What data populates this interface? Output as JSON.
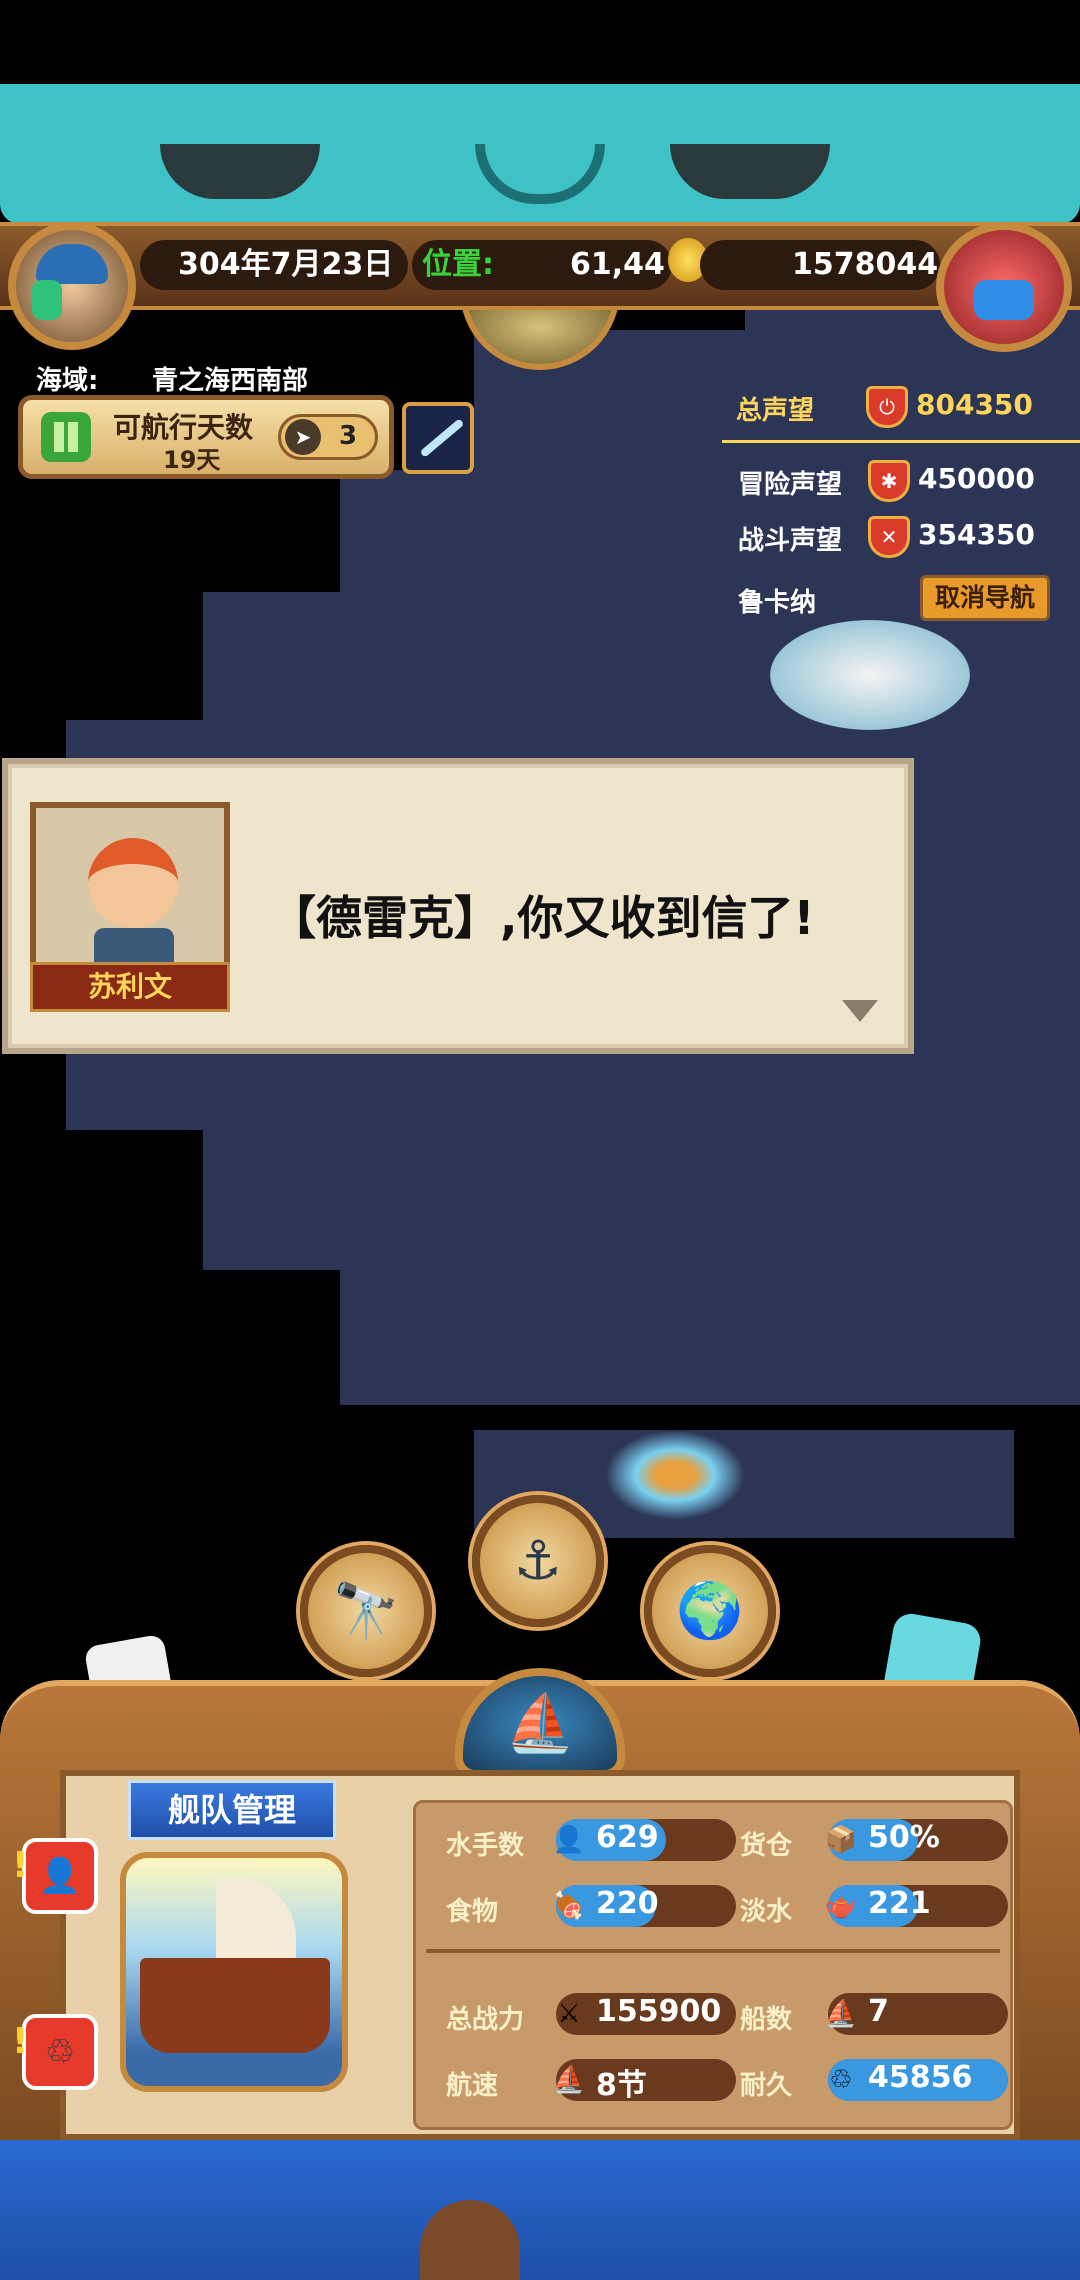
{
  "header": {
    "date": "304年7月23日",
    "position_label": "位置:",
    "position_value": "61,44",
    "gold": "1578044"
  },
  "sea_area": {
    "label": "海域:",
    "value": "青之海西南部"
  },
  "sail_days": {
    "label": "可航行天数",
    "days": "19天",
    "nav_count": "3"
  },
  "reputation": {
    "total_label": "总声望",
    "total_value": "804350",
    "adventure_label": "冒险声望",
    "adventure_value": "450000",
    "battle_label": "战斗声望",
    "battle_value": "354350",
    "destination": "鲁卡纳",
    "cancel_nav": "取消导航"
  },
  "dialog": {
    "speaker": "苏利文",
    "text": "【德雷克】,你又收到信了!"
  },
  "fleet": {
    "title": "舰队管理",
    "stats": {
      "sailors_label": "水手数",
      "sailors_value": "629",
      "cargo_label": "货仓",
      "cargo_value": "50%",
      "food_label": "食物",
      "food_value": "220",
      "water_label": "淡水",
      "water_value": "221",
      "power_label": "总战力",
      "power_value": "155900",
      "ships_label": "船数",
      "ships_value": "7",
      "speed_label": "航速",
      "speed_value": "8节",
      "durability_label": "耐久",
      "durability_value": "45856"
    }
  },
  "icons": {
    "spyglass": "spyglass-icon",
    "anchor": "anchor-icon",
    "globe": "globe-icon",
    "ship": "ship-icon"
  },
  "colors": {
    "accent_green": "#3bd13b",
    "accent_yellow": "#ffd65a",
    "bar_blue": "#3a98e0"
  }
}
